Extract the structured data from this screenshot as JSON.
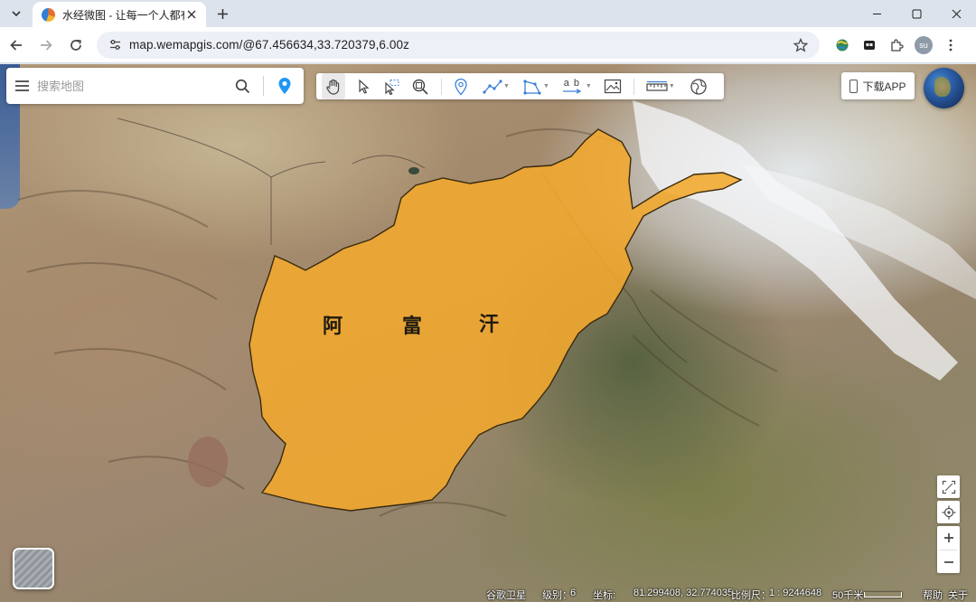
{
  "browser": {
    "tab_title": "水经微图 - 让每一个人都有自己",
    "url": "map.wemapgis.com/@67.456634,33.720379,6.00z",
    "profile_initials": "su",
    "accent_color": "#dde3ec"
  },
  "search": {
    "placeholder": "搜索地图"
  },
  "toolbar": {
    "label_tool_text": "a b"
  },
  "download": {
    "label": "下载APP"
  },
  "map": {
    "region_label_chars": [
      "阿",
      "富",
      "汗"
    ],
    "highlight_color": "#f2a92d"
  },
  "status": {
    "source": "谷歌卫星",
    "level_label": "级别：",
    "level_value": "6",
    "coord_label": "坐标:",
    "coord_value": "81.299408, 32.774035",
    "scale_label": "比例尺：",
    "scale_value": "1 : 9244648",
    "scale_bar": "50千米",
    "help": "帮助",
    "about": "关于"
  },
  "icons": {
    "tab_menu": "chevron-down-icon",
    "back": "arrow-left-icon",
    "forward": "arrow-right-icon",
    "reload": "reload-icon",
    "site_info": "tune-icon",
    "bookmark": "star-icon",
    "extensions": "puzzle-icon"
  }
}
